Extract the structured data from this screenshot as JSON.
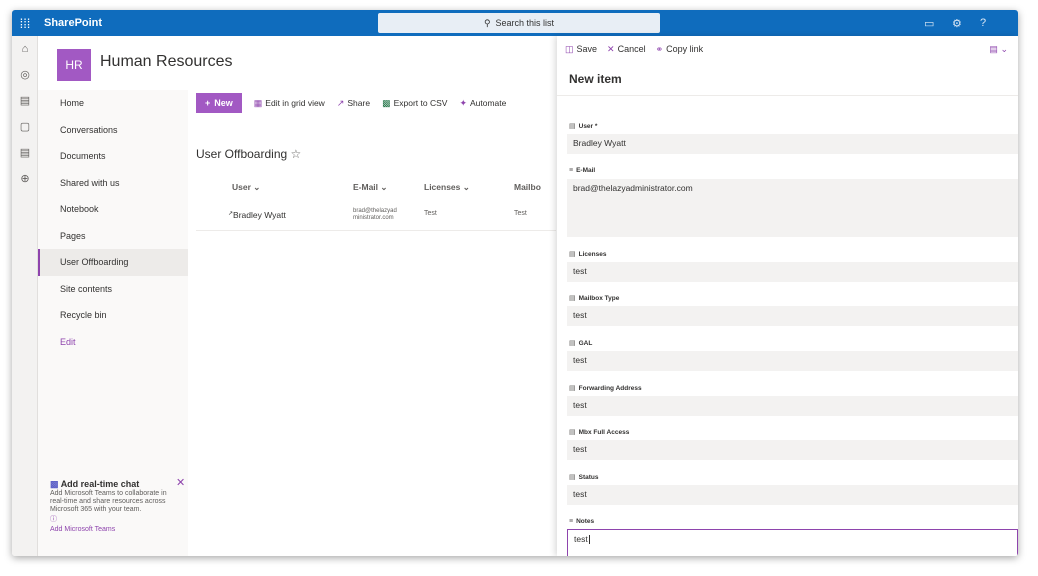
{
  "suite": {
    "app_name": "SharePoint",
    "search_placeholder": "Search this list"
  },
  "site": {
    "logo_text": "HR",
    "title": "Human Resources"
  },
  "nav": {
    "items": [
      "Home",
      "Conversations",
      "Documents",
      "Shared with us",
      "Notebook",
      "Pages",
      "User Offboarding",
      "Site contents",
      "Recycle bin",
      "Edit"
    ],
    "selected": "User Offboarding"
  },
  "chat": {
    "title": "Add real-time chat",
    "body": "Add Microsoft Teams to collaborate in real-time and share resources across Microsoft 365 with your team.",
    "link": "Add Microsoft Teams"
  },
  "command_bar": {
    "new": "New",
    "grid": "Edit in grid view",
    "share": "Share",
    "export": "Export to CSV",
    "automate": "Automate"
  },
  "list": {
    "title": "User Offboarding",
    "columns": [
      "User",
      "E-Mail",
      "Licenses",
      "Mailbo"
    ],
    "rows": [
      {
        "user": "Bradley Wyatt",
        "email": "brad@thelazyad ministrator.com",
        "licenses": "Test",
        "mailbox": "Test"
      }
    ]
  },
  "panel": {
    "toolbar": {
      "save": "Save",
      "cancel": "Cancel",
      "copy": "Copy link"
    },
    "title": "New item",
    "fields": [
      {
        "label": "User *",
        "value": "Bradley Wyatt"
      },
      {
        "label": "E-Mail",
        "value": "brad@thelazyadministrator.com"
      },
      {
        "label": "Licenses",
        "value": "test"
      },
      {
        "label": "Mailbox Type",
        "value": "test"
      },
      {
        "label": "GAL",
        "value": "test"
      },
      {
        "label": "Forwarding Address",
        "value": "test"
      },
      {
        "label": "Mbx Full Access",
        "value": "test"
      },
      {
        "label": "Status",
        "value": "test"
      },
      {
        "label": "Notes",
        "value": "test"
      }
    ]
  },
  "colors": {
    "suite_blue": "#0f6cbd",
    "accent_purple": "#a259c3"
  }
}
